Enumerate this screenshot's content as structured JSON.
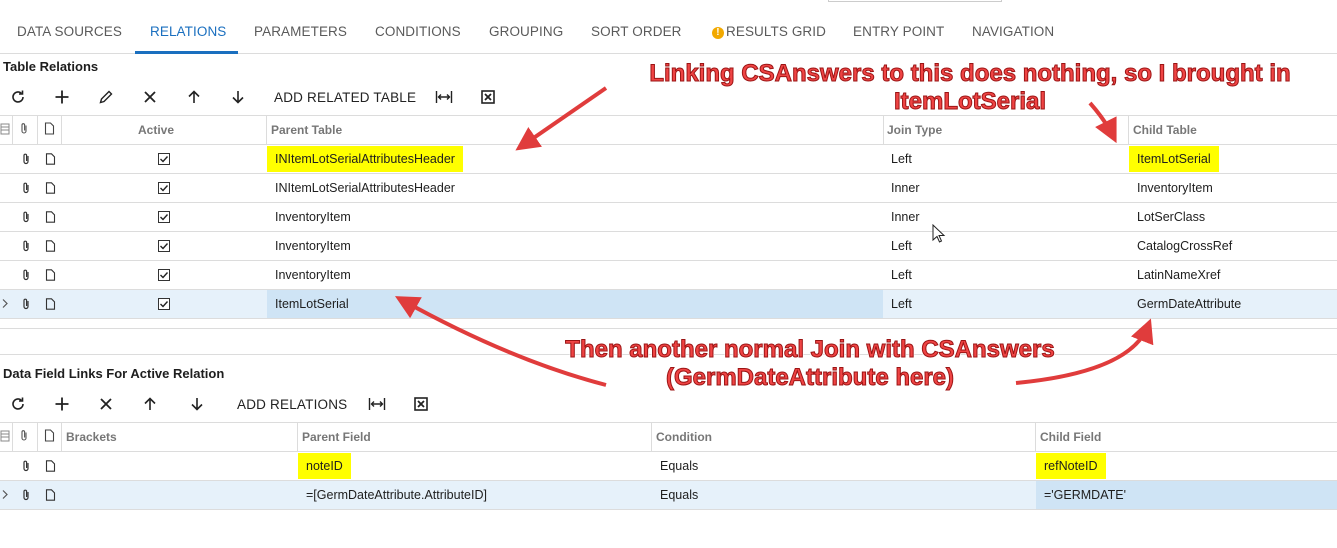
{
  "tabs": [
    {
      "label": "DATA SOURCES"
    },
    {
      "label": "RELATIONS",
      "active": true
    },
    {
      "label": "PARAMETERS"
    },
    {
      "label": "CONDITIONS"
    },
    {
      "label": "GROUPING"
    },
    {
      "label": "SORT ORDER"
    },
    {
      "label": "RESULTS GRID",
      "warning": true
    },
    {
      "label": "ENTRY POINT"
    },
    {
      "label": "NAVIGATION"
    }
  ],
  "relations": {
    "title": "Table Relations",
    "toolbar": {
      "add_label": "ADD RELATED TABLE"
    },
    "columns": {
      "active": "Active",
      "parent": "Parent Table",
      "join": "Join Type",
      "child": "Child Table"
    },
    "rows": [
      {
        "active": true,
        "parent": "INItemLotSerialAttributesHeader",
        "join": "Left",
        "child": "ItemLotSerial"
      },
      {
        "active": true,
        "parent": "INItemLotSerialAttributesHeader",
        "join": "Inner",
        "child": "InventoryItem"
      },
      {
        "active": true,
        "parent": "InventoryItem",
        "join": "Inner",
        "child": "LotSerClass"
      },
      {
        "active": true,
        "parent": "InventoryItem",
        "join": "Left",
        "child": "CatalogCrossRef"
      },
      {
        "active": true,
        "parent": "InventoryItem",
        "join": "Left",
        "child": "LatinNameXref"
      },
      {
        "active": true,
        "parent": "ItemLotSerial",
        "join": "Left",
        "child": "GermDateAttribute"
      }
    ]
  },
  "links": {
    "title": "Data Field Links For Active Relation",
    "toolbar": {
      "add_label": "ADD RELATIONS"
    },
    "columns": {
      "brackets": "Brackets",
      "parent": "Parent Field",
      "condition": "Condition",
      "child": "Child Field"
    },
    "rows": [
      {
        "parent": "noteID",
        "condition": "Equals",
        "child": "refNoteID"
      },
      {
        "parent": "=[GermDateAttribute.AttributeID]",
        "condition": "Equals",
        "child": "='GERMDATE'"
      }
    ]
  },
  "annotations": {
    "top": "Linking CSAnswers to this does nothing, so I brought in ItemLotSerial",
    "middle": "Then another normal Join with CSAnswers (GermDateAttribute here)"
  },
  "colors": {
    "accent": "#1a6fbf",
    "highlight": "#ffff00",
    "annotation": "#ef4444",
    "selected_row": "#e6f1fa"
  }
}
